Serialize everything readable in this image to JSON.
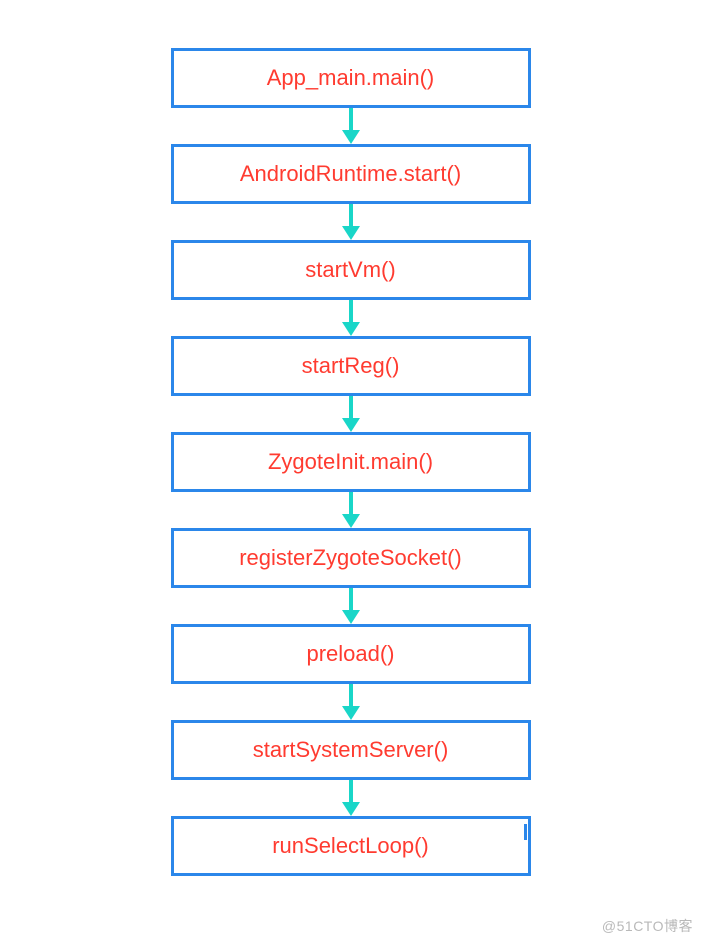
{
  "chart_data": {
    "type": "flowchart",
    "direction": "top-down",
    "nodes": [
      {
        "id": "n1",
        "label": "App_main.main()"
      },
      {
        "id": "n2",
        "label": "AndroidRuntime.start()"
      },
      {
        "id": "n3",
        "label": "startVm()"
      },
      {
        "id": "n4",
        "label": "startReg()"
      },
      {
        "id": "n5",
        "label": "ZygoteInit.main()"
      },
      {
        "id": "n6",
        "label": "registerZygoteSocket()"
      },
      {
        "id": "n7",
        "label": "preload()"
      },
      {
        "id": "n8",
        "label": "startSystemServer()"
      },
      {
        "id": "n9",
        "label": "runSelectLoop()"
      }
    ],
    "edges": [
      {
        "from": "n1",
        "to": "n2"
      },
      {
        "from": "n2",
        "to": "n3"
      },
      {
        "from": "n3",
        "to": "n4"
      },
      {
        "from": "n4",
        "to": "n5"
      },
      {
        "from": "n5",
        "to": "n6"
      },
      {
        "from": "n6",
        "to": "n7"
      },
      {
        "from": "n7",
        "to": "n8"
      },
      {
        "from": "n8",
        "to": "n9"
      }
    ],
    "node_border_color": "#2b87ea",
    "node_text_color": "#ff3b30",
    "arrow_color": "#19d6c8"
  },
  "watermark": "@51CTO博客"
}
